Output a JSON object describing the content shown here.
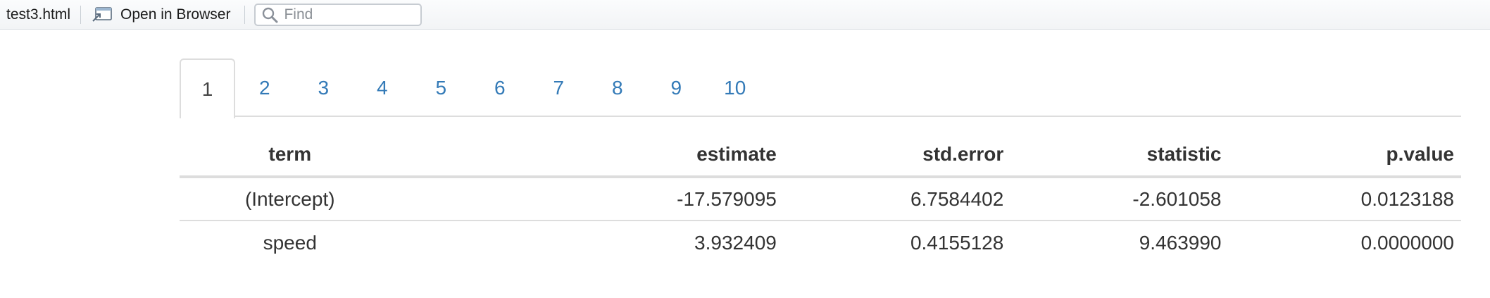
{
  "toolbar": {
    "filename": "test3.html",
    "open_label": "Open in Browser",
    "open_icon": "open-in-browser-icon",
    "find_placeholder": "Find",
    "find_value": "",
    "find_icon": "search-icon"
  },
  "tabs": [
    {
      "label": "1",
      "active": true
    },
    {
      "label": "2",
      "active": false
    },
    {
      "label": "3",
      "active": false
    },
    {
      "label": "4",
      "active": false
    },
    {
      "label": "5",
      "active": false
    },
    {
      "label": "6",
      "active": false
    },
    {
      "label": "7",
      "active": false
    },
    {
      "label": "8",
      "active": false
    },
    {
      "label": "9",
      "active": false
    },
    {
      "label": "10",
      "active": false
    }
  ],
  "table": {
    "headers": [
      "term",
      "estimate",
      "std.error",
      "statistic",
      "p.value"
    ],
    "rows": [
      [
        "(Intercept)",
        "-17.579095",
        "6.7584402",
        "-2.601058",
        "0.0123188"
      ],
      [
        "speed",
        "3.932409",
        "0.4155128",
        "9.463990",
        "0.0000000"
      ]
    ]
  },
  "colors": {
    "link": "#337ab7",
    "active_tab_text": "#444444",
    "border": "#dddddd",
    "text": "#333333"
  }
}
